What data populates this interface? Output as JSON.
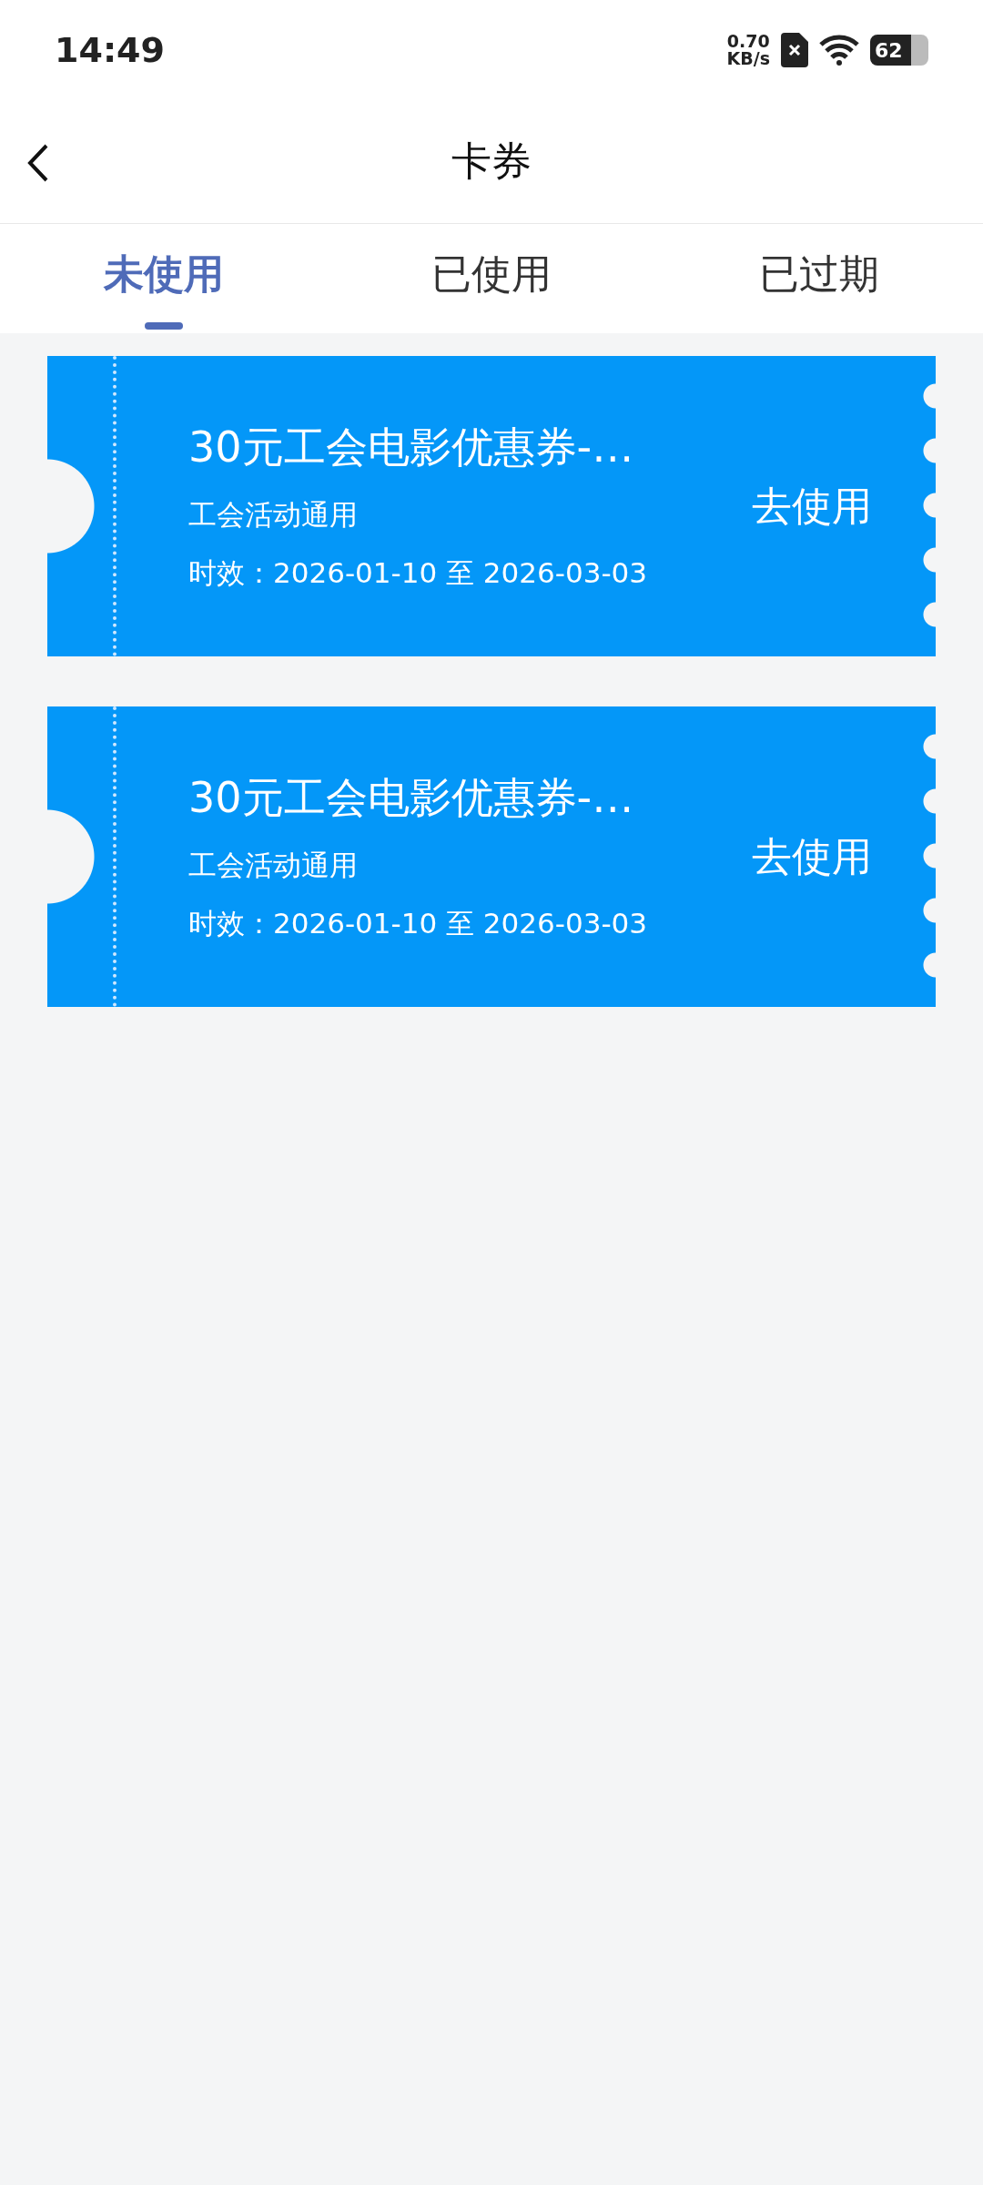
{
  "status_bar": {
    "time": "14:49",
    "net_speed": "0.70",
    "net_unit": "KB/s",
    "battery": "62"
  },
  "header": {
    "title": "卡券"
  },
  "tabs": [
    {
      "label": "未使用",
      "selected": true
    },
    {
      "label": "已使用",
      "selected": false
    },
    {
      "label": "已过期",
      "selected": false
    }
  ],
  "coupons": [
    {
      "title": "30元工会电影优惠券-…",
      "scope": "工会活动通用",
      "validity": "时效：2026-01-10 至 2026-03-03",
      "action": "去使用"
    },
    {
      "title": "30元工会电影优惠券-…",
      "scope": "工会活动通用",
      "validity": "时效：2026-01-10 至 2026-03-03",
      "action": "去使用"
    }
  ]
}
